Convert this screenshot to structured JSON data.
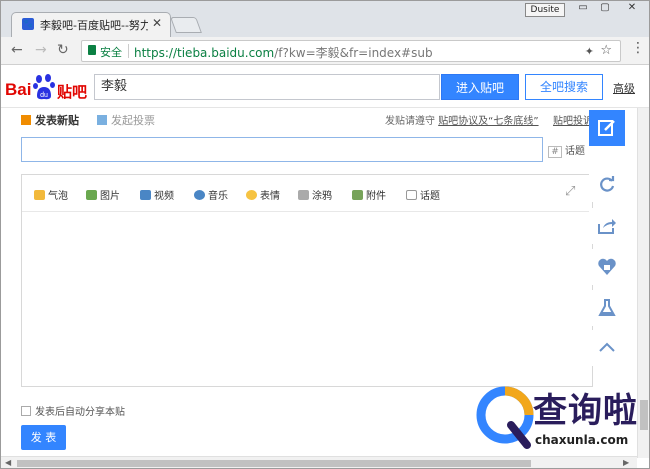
{
  "browser": {
    "tab_title": "李毅吧-百度贴吧--努力",
    "user_badge": "Dusite",
    "secure_label": "安全",
    "url_scheme": "https://",
    "url_host": "tieba.baidu.com",
    "url_path": "/f?kw=李毅&fr=index#sub"
  },
  "header": {
    "logo_bai": "Bai",
    "logo_du": "du",
    "logo_tieba": "贴吧",
    "search_value": "李毅",
    "enter_button": "进入贴吧",
    "all_search_button": "全吧搜索",
    "advanced_link": "高级"
  },
  "post": {
    "tab_new": "发表新贴",
    "tab_vote": "发起投票",
    "rule_prefix": "发贴请遵守",
    "rule_link": "贴吧协议及“七条底线”",
    "rule_link2": "贴吧投诉",
    "topic_button": "话题",
    "share_label": "发表后自动分享本贴",
    "publish_button": "发 表"
  },
  "editor_toolbar": [
    {
      "label": "气泡",
      "icon": "bubble-icon",
      "color": "#f2b93b"
    },
    {
      "label": "图片",
      "icon": "image-icon",
      "color": "#6aa84f"
    },
    {
      "label": "视频",
      "icon": "video-icon",
      "color": "#4a86c5"
    },
    {
      "label": "音乐",
      "icon": "music-icon",
      "color": "#4a86c5"
    },
    {
      "label": "表情",
      "icon": "emoji-icon",
      "color": "#f6c342"
    },
    {
      "label": "涂鸦",
      "icon": "graffiti-icon",
      "color": "#aaaaaa"
    },
    {
      "label": "附件",
      "icon": "attachment-icon",
      "color": "#77a35a"
    },
    {
      "label": "话题",
      "icon": "hashtag-icon",
      "color": "#999999"
    }
  ],
  "watermark": {
    "cn": "查询啦",
    "en": "chaxunla.com"
  },
  "colors": {
    "brand_blue": "#3385ff",
    "baidu_red": "#e10602",
    "secure_green": "#0b8043"
  }
}
